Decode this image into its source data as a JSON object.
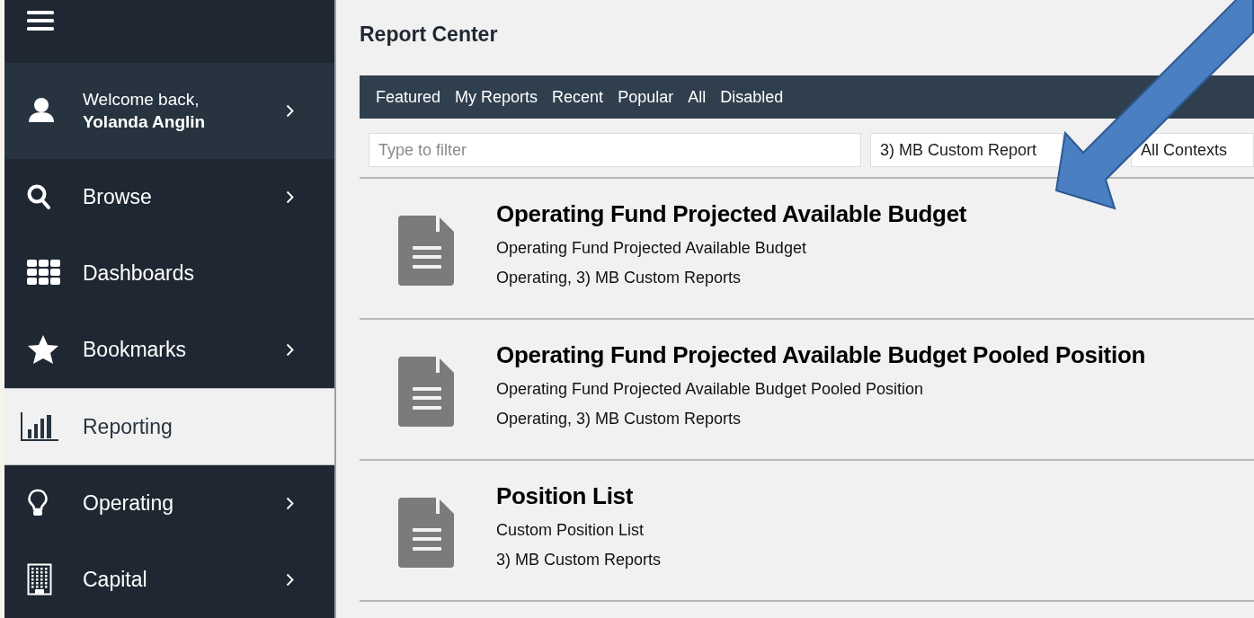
{
  "sidebar": {
    "welcome": {
      "greeting": "Welcome back,",
      "name": "Yolanda Anglin"
    },
    "items": [
      {
        "kind": "search",
        "label": "Browse",
        "selected": false,
        "has_submenu": true
      },
      {
        "kind": "grid",
        "label": "Dashboards",
        "selected": false,
        "has_submenu": false
      },
      {
        "kind": "star",
        "label": "Bookmarks",
        "selected": false,
        "has_submenu": true
      },
      {
        "kind": "chart",
        "label": "Reporting",
        "selected": true,
        "has_submenu": false
      },
      {
        "kind": "bulb",
        "label": "Operating",
        "selected": false,
        "has_submenu": true
      },
      {
        "kind": "building",
        "label": "Capital",
        "selected": false,
        "has_submenu": true
      }
    ]
  },
  "main": {
    "title": "Report Center",
    "tabs": [
      {
        "label": "Featured",
        "selected": false
      },
      {
        "label": "My Reports",
        "selected": false
      },
      {
        "label": "Recent",
        "selected": false
      },
      {
        "label": "Popular",
        "selected": false
      },
      {
        "label": "All",
        "selected": false
      },
      {
        "label": "Disabled",
        "selected": false
      }
    ],
    "filter": {
      "placeholder": "Type to filter"
    },
    "category_select": {
      "value": "3) MB Custom Report"
    },
    "context_select": {
      "value": "All Contexts"
    },
    "reports": [
      {
        "title": "Operating Fund Projected Available Budget",
        "description": "Operating Fund Projected Available Budget",
        "tags": "Operating, 3) MB Custom Reports"
      },
      {
        "title": "Operating Fund Projected Available Budget Pooled Position",
        "description": "Operating Fund Projected Available Budget Pooled Position",
        "tags": "Operating, 3) MB Custom Reports"
      },
      {
        "title": "Position List",
        "description": "Custom Position List",
        "tags": "3) MB Custom Reports"
      }
    ]
  }
}
